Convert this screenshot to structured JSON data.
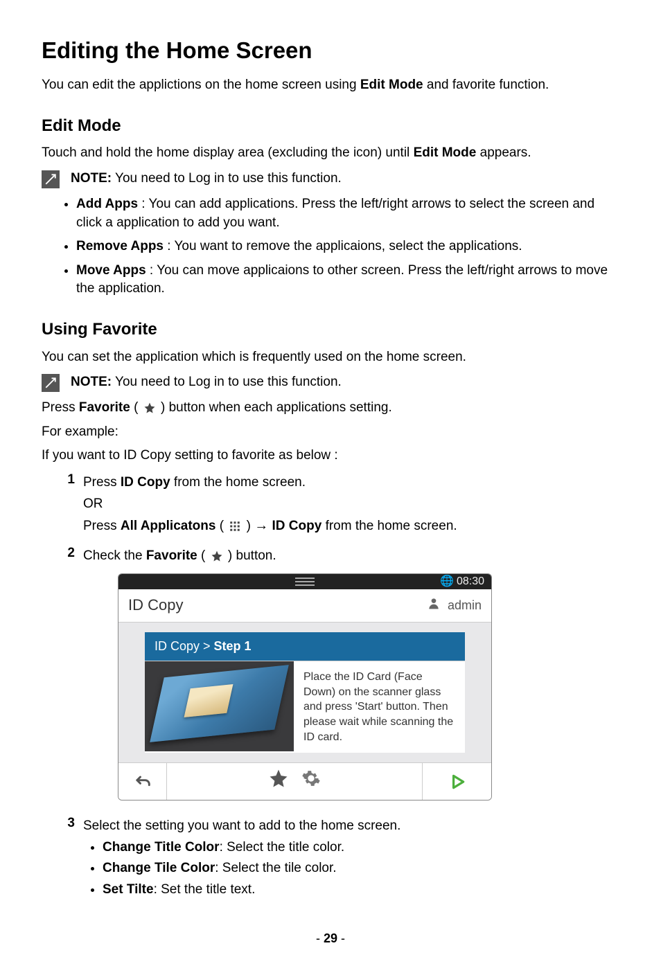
{
  "heading": "Editing the Home Screen",
  "intro_pre": "You can edit the applictions on the home screen using ",
  "intro_bold": "Edit Mode",
  "intro_post": " and favorite function.",
  "edit_mode": {
    "title": "Edit Mode",
    "line_pre": "Touch and hold the home display area (excluding the icon) until ",
    "line_bold": "Edit Mode",
    "line_post": " appears.",
    "note_label": "NOTE:",
    "note_text": " You need to Log in to use this function.",
    "bullets": {
      "add": {
        "bold": "Add Apps",
        "rest": " : You can add applications. Press the left/right arrows to select the screen and click a application to add you want."
      },
      "remove": {
        "bold": "Remove Apps",
        "rest": " : You want to remove the applicaions, select the applications."
      },
      "move": {
        "bold": "Move Apps",
        "rest": " : You can move applicaions to other screen. Press the left/right arrows to move the application."
      }
    }
  },
  "favorite": {
    "title": "Using Favorite",
    "line1": "You can set the application which is frequently used on the home screen.",
    "note_label": "NOTE:",
    "note_text": " You need to Log in to use this function.",
    "press_pre": "Press ",
    "press_bold": "Favorite",
    "press_post": " button when each applications setting.",
    "eg": "For example:",
    "if": "If you want to ID Copy setting to favorite as below :",
    "step1_num": "1",
    "step1_pre": "Press ",
    "step1_bold": "ID Copy",
    "step1_post": " from the home screen.",
    "step1_or": "OR",
    "step1_alt_pre": "Press ",
    "step1_alt_bold1": "All Applicatons",
    "step1_alt_mid": " (",
    "step1_alt_post1": " ) ",
    "step1_alt_arrow": "→",
    "step1_alt_bold2": " ID Copy",
    "step1_alt_end": " from the home screen.",
    "step2_num": "2",
    "step2_pre": "Check the ",
    "step2_bold": "Favorite",
    "step2_post": " ) button.",
    "step2_paren_open": " ( ",
    "step3_num": "3",
    "step3_text": "Select the setting you want to add to the home screen.",
    "step3_bullets": {
      "a": {
        "bold": "Change Title Color",
        "rest": ": Select the title color."
      },
      "b": {
        "bold": "Change Tile Color",
        "rest": ": Select the tile color."
      },
      "c": {
        "bold": "Set Tilte",
        "rest": ": Set the title text."
      }
    }
  },
  "device": {
    "time": "08:30",
    "title": "ID Copy",
    "user": "admin",
    "crumb_pre": "ID Copy > ",
    "crumb_bold": "Step 1",
    "instruction": "Place the ID Card (Face Down) on the scanner glass and press 'Start' button. Then please wait while scanning the ID card."
  },
  "page_number": "- 29 -",
  "page_number_bold": "29",
  "page_number_pre": "- ",
  "page_number_post": " -"
}
